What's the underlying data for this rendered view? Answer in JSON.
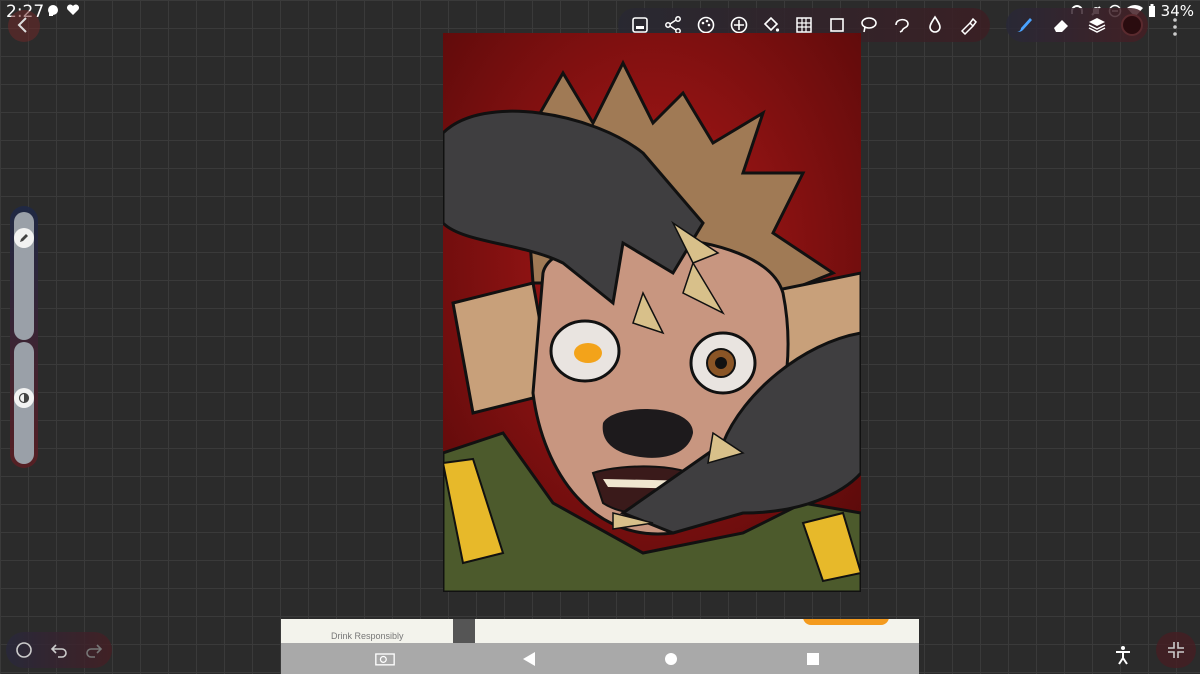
{
  "status_bar": {
    "time": "2:27",
    "battery": "34%"
  },
  "top_toolbar": {
    "tools": [
      "gallery-icon",
      "share-icon",
      "palette-icon",
      "add-icon",
      "bucket-icon",
      "grid-icon",
      "square-icon",
      "lasso-icon",
      "select-shape-icon",
      "dropper-icon",
      "adjust-icon"
    ]
  },
  "brush_toolbar": {
    "tools": [
      "brush-icon",
      "eraser-icon",
      "layers-icon",
      "color-swatch"
    ],
    "current_color": "#2a0c0f"
  },
  "side_panel": {
    "size_level": 0.85,
    "opacity_level": 0.55
  },
  "ad": {
    "disclaimer": "Drink Responsibly"
  },
  "colors": {
    "background": "#2b2b2b",
    "accent_orange": "#f39a1e",
    "artwork_bg": "#8a1212"
  }
}
